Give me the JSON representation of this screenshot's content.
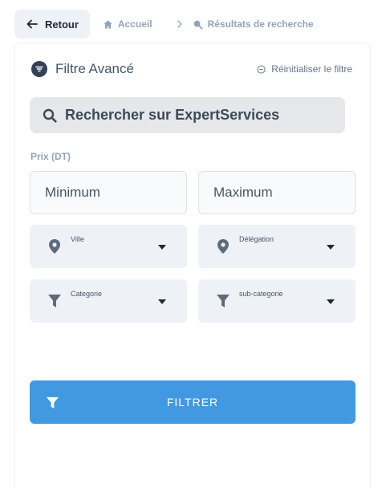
{
  "nav": {
    "back_label": "Retour",
    "crumbs": [
      {
        "label": "Accueil",
        "icon": "home-icon"
      },
      {
        "label": "Résultats de recherche",
        "icon": "search-icon"
      }
    ]
  },
  "filter": {
    "title": "Filtre Avancé",
    "reset_label": "Réinitialiser le filtre",
    "search_placeholder": "Rechercher sur ExpertServices",
    "price_label": "Prix (DT)",
    "min_placeholder": "Minimum",
    "max_placeholder": "Maximum",
    "selects": [
      {
        "label": "Ville",
        "icon": "map-pin-icon"
      },
      {
        "label": "Délégation",
        "icon": "map-pin-icon"
      },
      {
        "label": "Categorie",
        "icon": "funnel-icon"
      },
      {
        "label": "sub-categorie",
        "icon": "funnel-icon"
      }
    ],
    "submit_label": "FILTRER"
  },
  "colors": {
    "accent": "#4299e1",
    "field_bg": "#eef2f7",
    "search_bg": "#e5e7eb"
  }
}
